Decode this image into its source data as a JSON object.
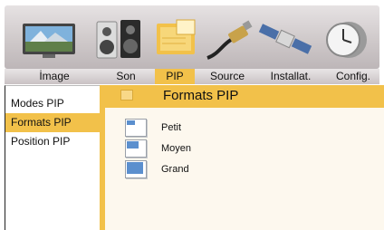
{
  "top_icons": [
    "tv-image-icon",
    "speakers-icon",
    "pip-icon",
    "cable-plug-icon",
    "satellite-icon",
    "clock-gear-icon"
  ],
  "tabs": [
    {
      "label": "İmage"
    },
    {
      "label": "Son"
    },
    {
      "label": "PIP"
    },
    {
      "label": "Source"
    },
    {
      "label": "Installat."
    },
    {
      "label": "Config."
    }
  ],
  "active_tab": "PIP",
  "sidebar": {
    "items": [
      {
        "label": "Modes PIP"
      },
      {
        "label": "Formats PIP"
      },
      {
        "label": "Position PIP"
      }
    ],
    "selected": "Formats PIP"
  },
  "panel": {
    "title": "Formats PIP",
    "header_icon": "pip-window-icon",
    "options": [
      {
        "label": "Petit",
        "icon": "pip-small-icon"
      },
      {
        "label": "Moyen",
        "icon": "pip-medium-icon"
      },
      {
        "label": "Grand",
        "icon": "pip-large-icon"
      }
    ]
  },
  "colors": {
    "accent": "#f2c14a",
    "panel_bg": "#fdf8ee",
    "pip_blue": "#5b8fce"
  }
}
